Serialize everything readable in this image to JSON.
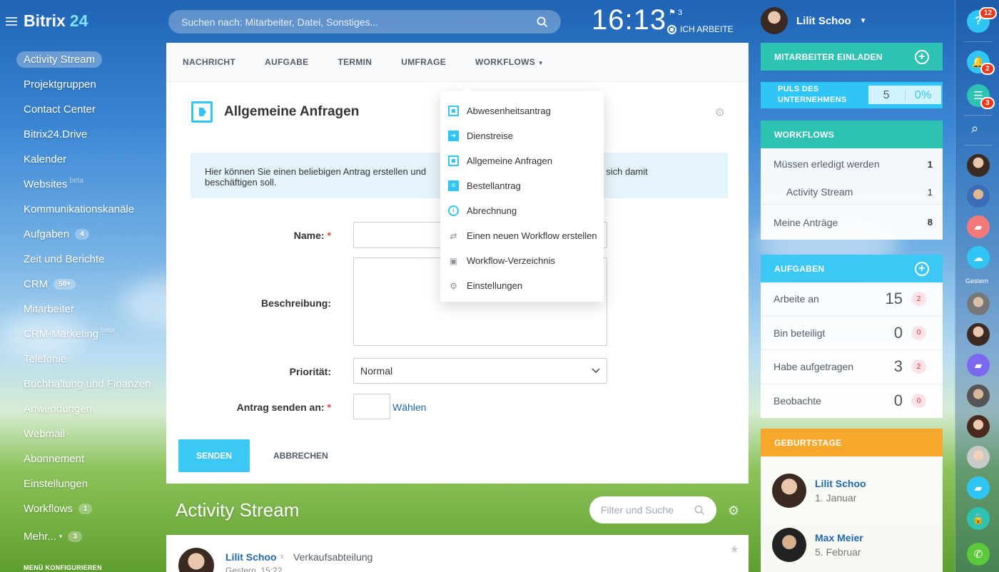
{
  "brand": {
    "name": "Bitrix",
    "number": "24"
  },
  "nav": {
    "items": [
      {
        "label": "Activity Stream",
        "active": true
      },
      {
        "label": "Projektgruppen"
      },
      {
        "label": "Contact Center"
      },
      {
        "label": "Bitrix24.Drive"
      },
      {
        "label": "Kalender"
      },
      {
        "label": "Websites",
        "sup": "beta"
      },
      {
        "label": "Kommunikationskanäle"
      },
      {
        "label": "Aufgaben",
        "badge": "4"
      },
      {
        "label": "Zeit und Berichte"
      },
      {
        "label": "CRM",
        "badge": "50+"
      },
      {
        "label": "Mitarbeiter"
      },
      {
        "label": "CRM-Marketing",
        "sup": "beta"
      },
      {
        "label": "Telefonie"
      },
      {
        "label": "Buchhaltung und Finanzen"
      },
      {
        "label": "Anwendungen"
      },
      {
        "label": "Webmail"
      },
      {
        "label": "Abonnement"
      },
      {
        "label": "Einstellungen"
      },
      {
        "label": "Workflows",
        "badge": "1"
      },
      {
        "label": "Mehr...",
        "badge": "3"
      }
    ],
    "configure": "MENÜ KONFIGURIEREN"
  },
  "header": {
    "search_placeholder": "Suchen nach: Mitarbeiter, Datei, Sonstiges...",
    "time": "16:13",
    "flags": "3",
    "status": "ICH ARBEITE",
    "user": "Lilit Schoo"
  },
  "composer": {
    "tabs": [
      "NACHRICHT",
      "AUFGABE",
      "TERMIN",
      "UMFRAGE",
      "WORKFLOWS"
    ],
    "title": "Allgemeine Anfragen",
    "info": "Hier können Sie einen beliebigen Antrag erstellen und                                                                                                                    er sich damit beschäftigen soll.",
    "info_line1": "Hier können Sie einen beliebigen Antrag erstellen und",
    "info_line1b": "er sich damit",
    "info_line2": "beschäftigen soll.",
    "fields": {
      "name": "Name:",
      "description": "Beschreibung:",
      "priority": "Priorität:",
      "priority_value": "Normal",
      "send_to": "Antrag senden an:",
      "choose": "Wählen"
    },
    "send": "SENDEN",
    "cancel": "ABBRECHEN"
  },
  "workflow_menu": [
    {
      "label": "Abwesenheitsantrag",
      "icon": "edit-icon"
    },
    {
      "label": "Dienstreise",
      "icon": "travel-icon"
    },
    {
      "label": "Allgemeine Anfragen",
      "icon": "request-icon"
    },
    {
      "label": "Bestellantrag",
      "icon": "order-icon"
    },
    {
      "label": "Abrechnung",
      "icon": "billing-icon"
    },
    {
      "label": "Einen neuen Workflow erstellen",
      "icon": "refresh-icon"
    },
    {
      "label": "Workflow-Verzeichnis",
      "icon": "bag-icon"
    },
    {
      "label": "Einstellungen",
      "icon": "gear-icon"
    }
  ],
  "stream": {
    "title": "Activity Stream",
    "filter_placeholder": "Filter und Suche",
    "post": {
      "author": "Lilit Schoo",
      "destination": "Verkaufsabteilung",
      "time": "Gestern, 15:22"
    }
  },
  "right": {
    "invite": "MITARBEITER EINLADEN",
    "puls_line1": "PULS DES",
    "puls_line2": "UNTERNEHMENS",
    "puls_value": "5",
    "puls_pct": "0%",
    "workflows": {
      "title": "WORKFLOWS",
      "rows": [
        {
          "label": "Müssen erledigt werden",
          "count": "1"
        },
        {
          "label": "Activity Stream",
          "count": "1"
        },
        {
          "label": "Meine Anträge",
          "count": "8"
        }
      ]
    },
    "tasks": {
      "title": "AUFGABEN",
      "rows": [
        {
          "label": "Arbeite an",
          "count": "15",
          "new": "2"
        },
        {
          "label": "Bin beteiligt",
          "count": "0",
          "new": "0"
        },
        {
          "label": "Habe aufgetragen",
          "count": "3",
          "new": "2"
        },
        {
          "label": "Beobachte",
          "count": "0",
          "new": "0"
        }
      ]
    },
    "birthdays": {
      "title": "GEBURTSTAGE",
      "people": [
        {
          "name": "Lilit Schoo",
          "date": "1. Januar"
        },
        {
          "name": "Max Meier",
          "date": "5. Februar"
        }
      ]
    }
  },
  "rail": {
    "help_badge": "12",
    "notif_badge": "2",
    "chat_badge": "3",
    "gestern": "Gestern"
  },
  "colors": {
    "accent": "#2fc6f6",
    "teal": "#2dc2b2",
    "orange": "#f7a72b",
    "link": "#2067b0"
  }
}
